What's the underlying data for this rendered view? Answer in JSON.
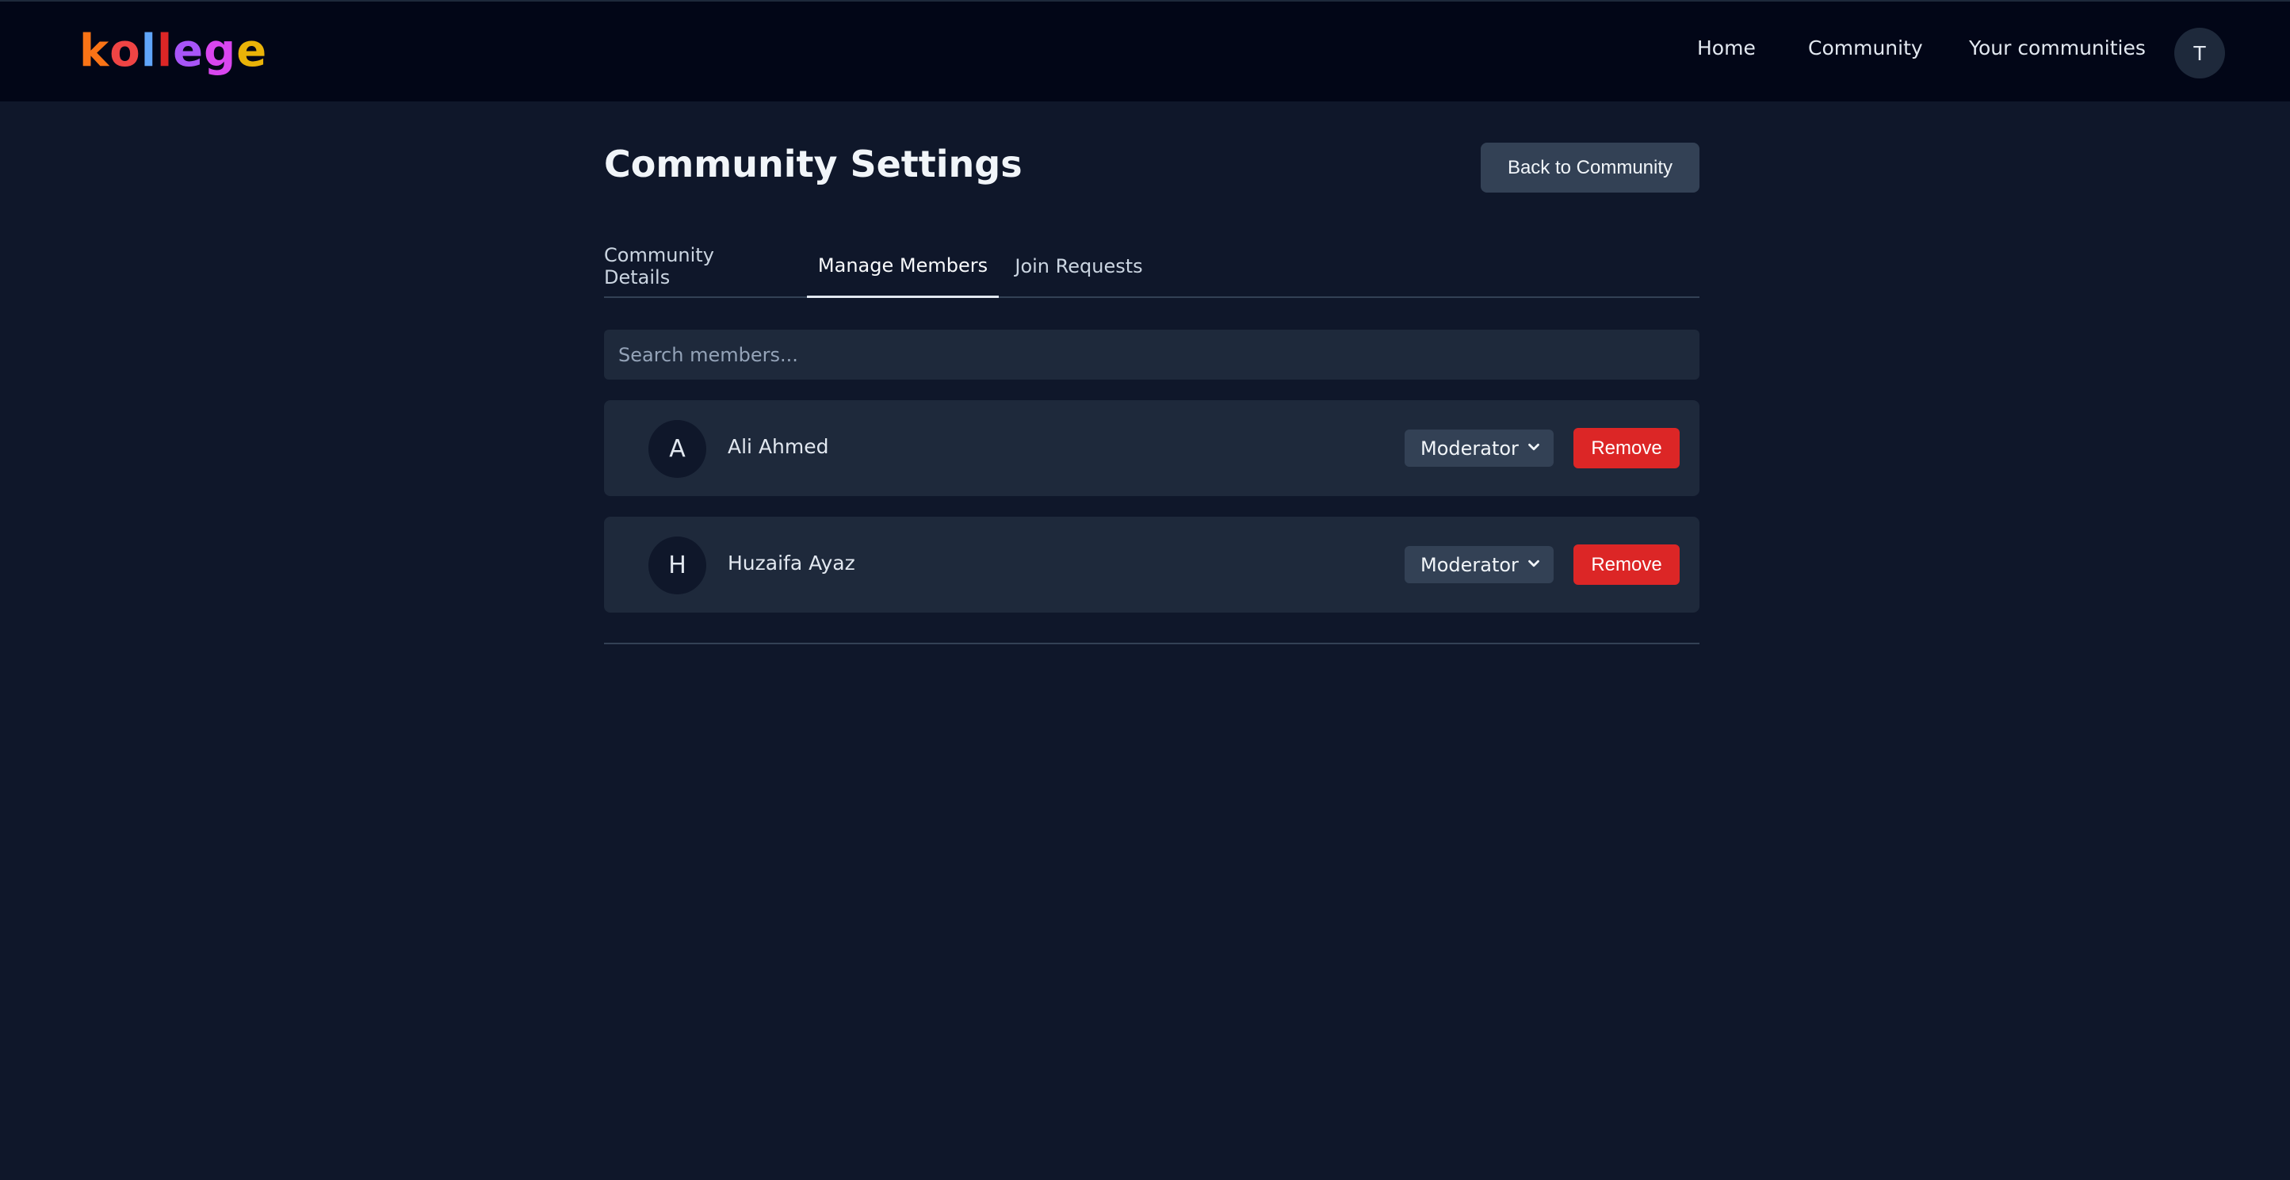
{
  "header": {
    "logo": [
      {
        "ch": "k",
        "color": "#f97316"
      },
      {
        "ch": "o",
        "color": "#ef4444"
      },
      {
        "ch": "l",
        "color": "#60a5fa"
      },
      {
        "ch": "l",
        "color": "#dc2626"
      },
      {
        "ch": "e",
        "color": "#a855f7"
      },
      {
        "ch": "g",
        "color": "#d946ef"
      },
      {
        "ch": "e",
        "color": "#eab308"
      }
    ],
    "nav": [
      "Home",
      "Community",
      "Your communities"
    ],
    "avatar_initial": "T"
  },
  "page": {
    "title": "Community Settings",
    "back_label": "Back to Community"
  },
  "tabs": [
    {
      "label": "Community Details",
      "active": false
    },
    {
      "label": "Manage Members",
      "active": true
    },
    {
      "label": "Join Requests",
      "active": false
    }
  ],
  "search": {
    "placeholder": "Search members..."
  },
  "members": [
    {
      "initial": "A",
      "name": "Ali Ahmed",
      "role": "Moderator",
      "action": "Remove"
    },
    {
      "initial": "H",
      "name": "Huzaifa Ayaz",
      "role": "Moderator",
      "action": "Remove"
    }
  ],
  "colors": {
    "background": "#0f172a",
    "navbar": "#020617",
    "card": "#1e293b",
    "danger": "#dc2626"
  }
}
